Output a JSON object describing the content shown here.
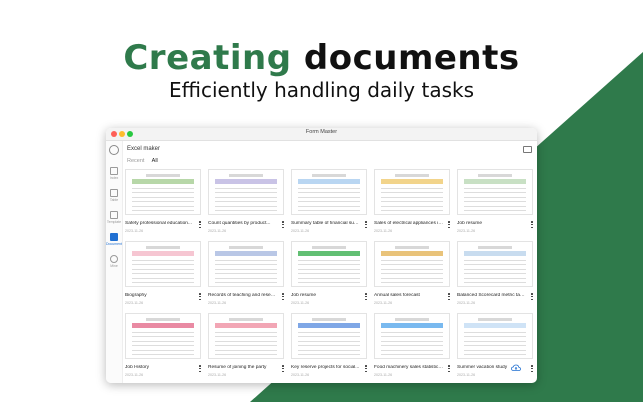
{
  "headline": {
    "part1": "Creating",
    "part2": "documents"
  },
  "subheadline": "Efficiently handling daily tasks",
  "colors": {
    "brand_green": "#2f7a4b",
    "accent_blue": "#1f6fd1"
  },
  "window": {
    "title": "Form Master"
  },
  "header": {
    "title": "Excel maker"
  },
  "tabs": [
    {
      "label": "Recent"
    },
    {
      "label": "All"
    }
  ],
  "sidebar": {
    "items": [
      {
        "label": "Index",
        "icon": "home-icon"
      },
      {
        "label": "Table",
        "icon": "table-icon"
      },
      {
        "label": "Template",
        "icon": "template-icon"
      },
      {
        "label": "Document",
        "icon": "document-icon"
      },
      {
        "label": "Mine",
        "icon": "user-icon"
      }
    ]
  },
  "documents": [
    {
      "title": "Safety professional education...",
      "date": "2023-11-26"
    },
    {
      "title": "Count quantities by product...",
      "date": "2023-11-26"
    },
    {
      "title": "Summary table of financial support...",
      "date": "2023-11-26"
    },
    {
      "title": "Sales of electrical appliances in...",
      "date": "2023-11-26"
    },
    {
      "title": "Job resume",
      "date": "2023-11-26"
    },
    {
      "title": "Biography",
      "date": "2023-11-26"
    },
    {
      "title": "Records of teaching and research...",
      "date": "2023-11-26"
    },
    {
      "title": "Job resume",
      "date": "2023-11-26"
    },
    {
      "title": "Annual sales forecast",
      "date": "2023-11-26"
    },
    {
      "title": "Balanced Scorecard metric tagging...",
      "date": "2023-11-26"
    },
    {
      "title": "Job History",
      "date": "2023-11-26"
    },
    {
      "title": "Resume of joining the party",
      "date": "2023-11-26"
    },
    {
      "title": "Key reserve projects for social...",
      "date": "2023-11-26"
    },
    {
      "title": "Food machinery sales statistics table",
      "date": "2023-11-26"
    },
    {
      "title": "Summer vacation study",
      "date": "2023-11-26"
    }
  ]
}
